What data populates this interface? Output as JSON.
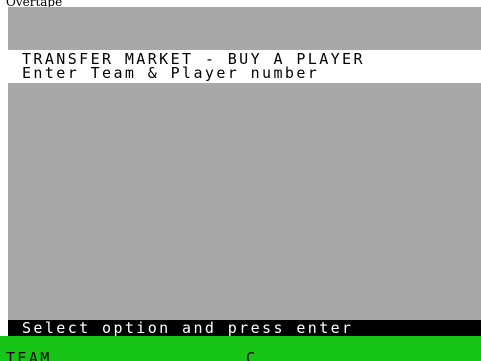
{
  "window": {
    "caption": "Overtape"
  },
  "screen": {
    "title": "TRANSFER MARKET - BUY A PLAYER",
    "subtitle": "Enter Team & Player number",
    "prompt": "Select option and press enter",
    "input_label": "TEAM",
    "cursor": "C"
  },
  "colors": {
    "play_area": "#a8a8a8",
    "header_band": "#ffffff",
    "prompt_bar": "#000000",
    "prompt_text": "#ffffff",
    "input_bar": "#17c517"
  }
}
